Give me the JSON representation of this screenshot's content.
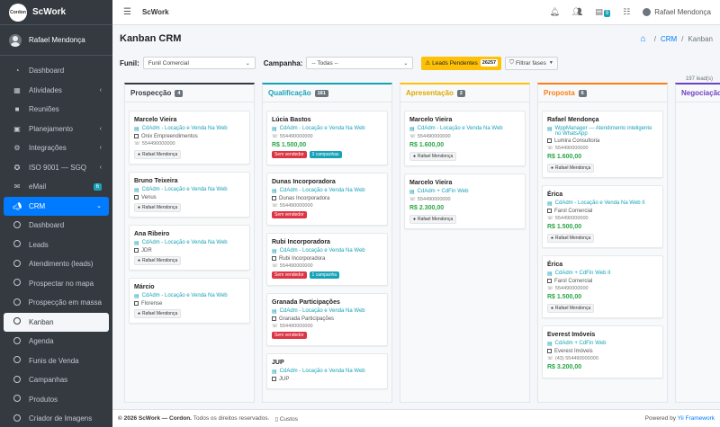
{
  "app": {
    "brand": "ScWork",
    "logo_text": "Cordon",
    "user": "Rafael Mendonça"
  },
  "sidebar": {
    "user": "Rafael Mendonça",
    "items": [
      {
        "label": "Dashboard",
        "icon": "tachometer-icon"
      },
      {
        "label": "Atividades",
        "icon": "calendar-icon",
        "chevron": "‹"
      },
      {
        "label": "Reuniões",
        "icon": "video-icon"
      },
      {
        "label": "Planejamento",
        "icon": "briefcase-icon",
        "chevron": "‹"
      },
      {
        "label": "Integrações",
        "icon": "cogs-icon",
        "chevron": "‹"
      },
      {
        "label": "ISO 9001 — SGQ",
        "icon": "certificate-icon",
        "chevron": "‹"
      },
      {
        "label": "eMail",
        "icon": "envelope-icon",
        "badge": "6"
      },
      {
        "label": "CRM",
        "icon": "bullhorn-icon",
        "chevron": "⌄"
      }
    ],
    "crm_items": [
      "Dashboard",
      "Leads",
      "Atendimento (leads)",
      "Prospectar no mapa",
      "Prospecção em massa",
      "Kanban",
      "Agenda",
      "Funis de Venda",
      "Campanhas",
      "Produtos",
      "Criador de Imagens"
    ]
  },
  "topbar": {
    "title": "ScWork",
    "badge": "9",
    "user": "Rafael Mendonça"
  },
  "page": {
    "title": "Kanban CRM",
    "breadcrumb": [
      "CRM",
      "Kanban"
    ],
    "funil_label": "Funil:",
    "funil_value": "Funil Comercial",
    "campanha_label": "Campanha:",
    "campanha_value": "-- Todas --",
    "leads_pendentes": "Leads Pendentes",
    "leads_pendentes_count": "26257",
    "filtrar": "Filtrar fases",
    "total": "197 lead(s)"
  },
  "colors": {
    "prospeccao": "#6c757d",
    "qualificacao": "#17a2b8",
    "apresentacao": "#ffc107",
    "proposta": "#fd7e14",
    "negociacao": "#6f42c1",
    "value": "#28a745"
  },
  "columns": [
    {
      "name": "Prospecção",
      "count": "4",
      "color": "#343a40",
      "border": "#343a40",
      "cards": [
        {
          "title": "Marcelo Vieira",
          "campaign": "CdAdm - Locação e Venda Na Web",
          "company": "Onix Empreendimentos",
          "phone": "554490000000",
          "owner": "Rafael Mendonça"
        },
        {
          "title": "Bruno Teixeira",
          "campaign": "CdAdm - Locação e Venda Na Web",
          "company": "Venus",
          "owner": "Rafael Mendonça"
        },
        {
          "title": "Ana Ribeiro",
          "campaign": "CdAdm - Locação e Venda Na Web",
          "company": "JDR",
          "owner": "Rafael Mendonça"
        },
        {
          "title": "Márcio",
          "campaign": "CdAdm - Locação e Venda Na Web",
          "company": "Florense",
          "owner": "Rafael Mendonça"
        }
      ]
    },
    {
      "name": "Qualificação",
      "count": "181",
      "color": "#17a2b8",
      "border": "#17a2b8",
      "cards": [
        {
          "title": "Lúcia Bastos",
          "campaign": "CdAdm - Locação e Venda Na Web",
          "phone": "554490000000",
          "value": "R$ 1.500,00",
          "tags": [
            "Sem vendedor",
            "3 campanhas"
          ]
        },
        {
          "title": "Dunas Incorporadora",
          "campaign": "CdAdm - Locação e Venda Na Web",
          "company": "Dunas Incorporadora",
          "phone": "554490000000",
          "tags": [
            "Sem vendedor"
          ]
        },
        {
          "title": "Rubi Incorporadora",
          "campaign": "CdAdm - Locação e Venda Na Web",
          "company": "Rubi Incorporadora",
          "phone": "554490000000",
          "tags": [
            "Sem vendedor",
            "1 campanha"
          ]
        },
        {
          "title": "Granada Participações",
          "campaign": "CdAdm - Locação e Venda Na Web",
          "company": "Granada Participações",
          "phone": "554490000000",
          "tags": [
            "Sem vendedor"
          ]
        },
        {
          "title": "JUP",
          "campaign": "CdAdm - Locação e Venda Na Web",
          "company": "JUP"
        }
      ]
    },
    {
      "name": "Apresentação",
      "count": "2",
      "color": "#e0a800",
      "border": "#ffc107",
      "cards": [
        {
          "title": "Marcelo Vieira",
          "campaign": "CdAdm - Locação e Venda Na Web",
          "phone": "554490000000",
          "value": "R$ 1.600,00",
          "owner": "Rafael Mendonça"
        },
        {
          "title": "Marcelo Vieira",
          "campaign": "CdAdm + CdFin Web",
          "phone": "554490000000",
          "value": "R$ 2.300,00",
          "owner": "Rafael Mendonça"
        }
      ]
    },
    {
      "name": "Proposta",
      "count": "6",
      "color": "#fd7e14",
      "border": "#fd7e14",
      "cards": [
        {
          "title": "Rafael Mendonça",
          "campaign": "WppManager — Atendimento inteligente no WhatsApp",
          "company": "Lumira Consultoria",
          "phone": "554490000000",
          "value": "R$ 1.600,00",
          "owner": "Rafael Mendonça"
        },
        {
          "title": "Érica",
          "campaign": "CdAdm - Locação e Venda Na Web II",
          "company": "Farol Comercial",
          "phone": "554490000000",
          "value": "R$ 1.500,00",
          "owner": "Rafael Mendonça"
        },
        {
          "title": "Érica",
          "campaign": "CdAdm + CdFin Web II",
          "company": "Farol Comercial",
          "phone": "554490000000",
          "value": "R$ 1.500,00",
          "owner": "Rafael Mendonça"
        },
        {
          "title": "Everest Imóveis",
          "campaign": "CdAdm + CdFin Web",
          "company": "Everest Imóveis",
          "phone": "(43) 554490000000",
          "value": "R$ 3.200,00"
        }
      ]
    },
    {
      "name": "Negociação",
      "count": "",
      "color": "#6f42c1",
      "border": "#6f42c1",
      "cards": []
    }
  ],
  "footer": {
    "copy": "© 2026 ScWork — Cordon.",
    "rights": "Todos os direitos reservados.",
    "costs": "Custos",
    "powered": "Powered by",
    "framework": "Yii Framework"
  }
}
